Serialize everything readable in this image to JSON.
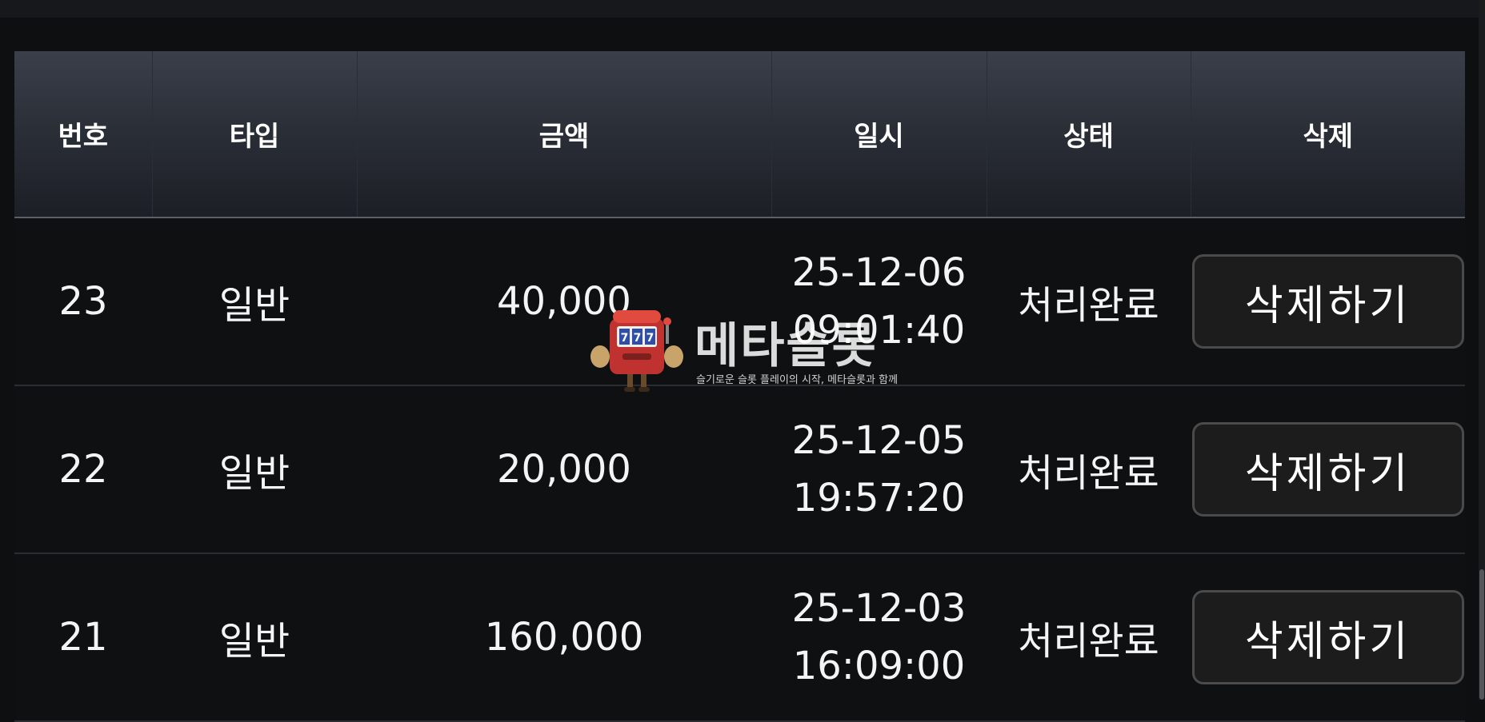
{
  "table": {
    "headers": [
      "번호",
      "타입",
      "금액",
      "일시",
      "상태",
      "삭제"
    ],
    "rows": [
      {
        "no": "23",
        "type": "일반",
        "amount": "40,000",
        "date": "25-12-06",
        "time": "09:01:40",
        "status": "처리완료",
        "action": "삭제하기"
      },
      {
        "no": "22",
        "type": "일반",
        "amount": "20,000",
        "date": "25-12-05",
        "time": "19:57:20",
        "status": "처리완료",
        "action": "삭제하기"
      },
      {
        "no": "21",
        "type": "일반",
        "amount": "160,000",
        "date": "25-12-03",
        "time": "16:09:00",
        "status": "처리완료",
        "action": "삭제하기"
      }
    ]
  },
  "watermark": {
    "title": "메타슬롯",
    "subtitle": "슬기로운 슬롯 플레이의 시작, 메타슬롯과 함께",
    "icon": "slot-machine-mascot-icon"
  },
  "colors": {
    "header_top": "#3a3f4a",
    "header_bottom": "#1c1f25",
    "background": "#0e0f11",
    "button_border": "#4a4a4a",
    "mascot_red": "#c0322f"
  }
}
